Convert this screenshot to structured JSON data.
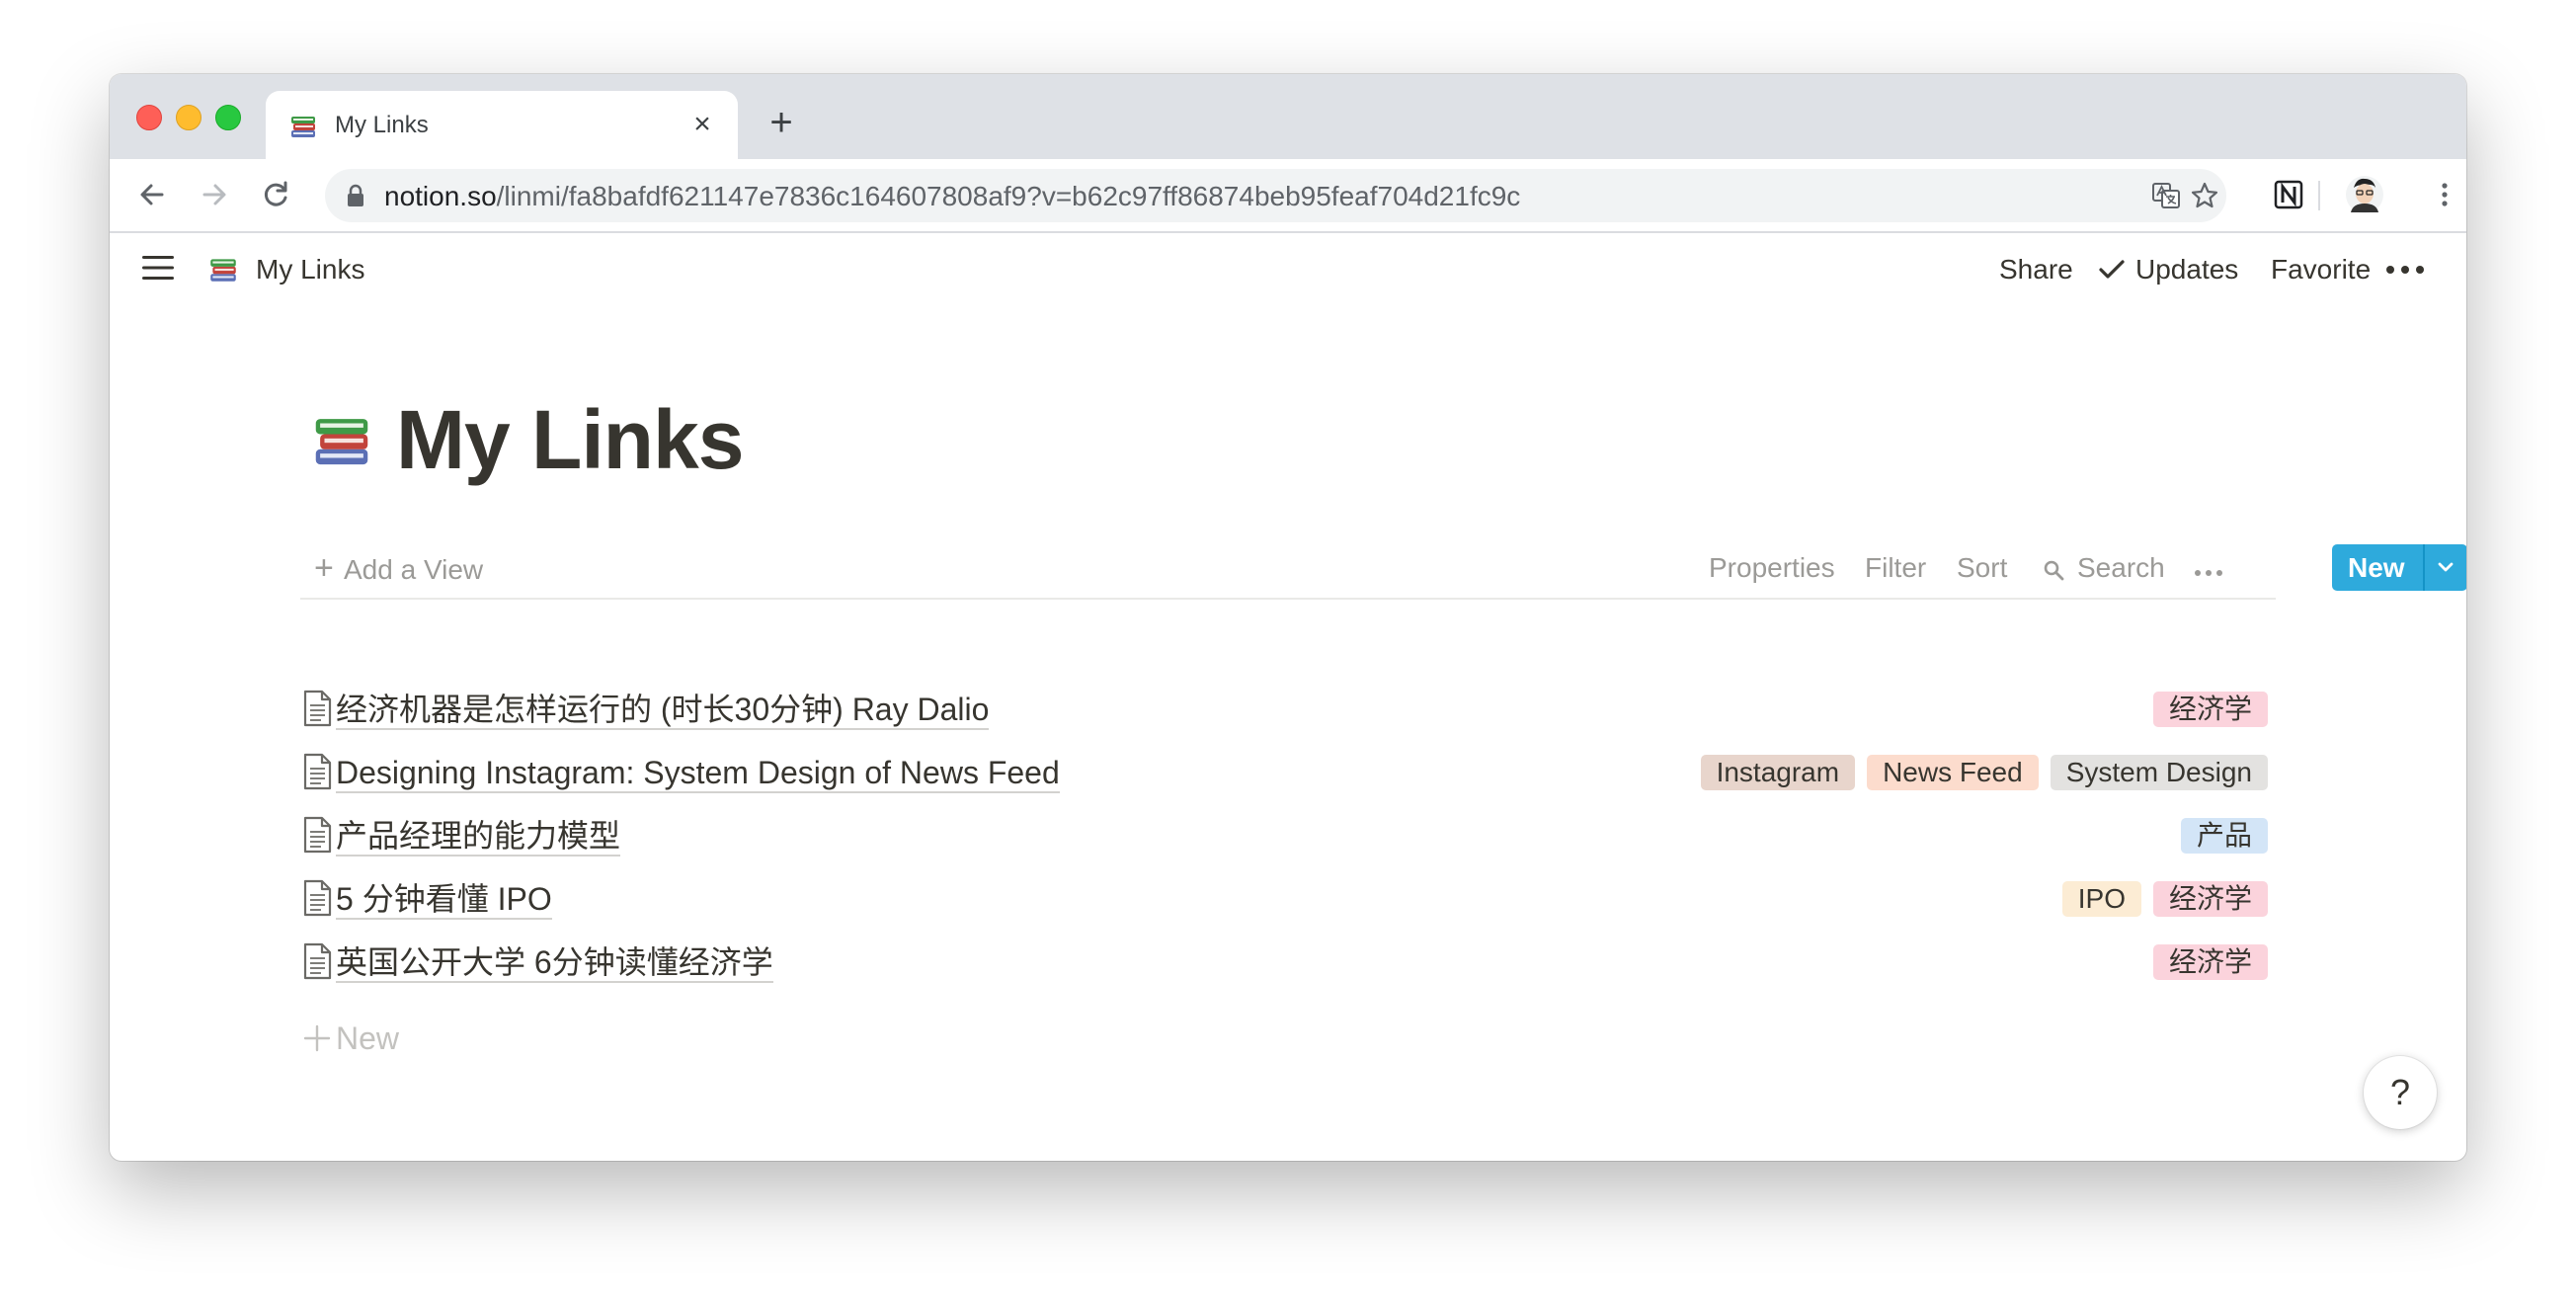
{
  "browser": {
    "tab_title": "My Links",
    "tab_close": "×",
    "new_tab": "+",
    "url_domain": "notion.so",
    "url_path": "/linmi/fa8bafdf621147e7836c164607808af9?v=b62c97ff86874beb95feaf704d21fc9c",
    "icons": [
      "back-icon",
      "forward-icon",
      "reload-icon",
      "lock-icon",
      "translate-icon",
      "star-icon",
      "notion-extension-icon",
      "profile-avatar",
      "kebab-menu-icon"
    ]
  },
  "topbar": {
    "breadcrumb_title": "My Links",
    "share": "Share",
    "updates": "Updates",
    "favorite": "Favorite"
  },
  "page": {
    "title": "My Links",
    "emoji": "books"
  },
  "viewbar": {
    "add_view": "Add a View",
    "properties": "Properties",
    "filter": "Filter",
    "sort": "Sort",
    "search": "Search",
    "new": "New"
  },
  "rows": [
    {
      "title": "经济机器是怎样运行的 (时长30分钟) Ray Dalio",
      "tags": [
        {
          "label": "经济学",
          "color": "#fbd3dc"
        }
      ]
    },
    {
      "title": "Designing Instagram: System Design of News Feed",
      "tags": [
        {
          "label": "Instagram",
          "color": "#e8d5cc"
        },
        {
          "label": "News Feed",
          "color": "#fcdccd"
        },
        {
          "label": "System Design",
          "color": "#e3e2e0"
        }
      ]
    },
    {
      "title": "产品经理的能力模型",
      "tags": [
        {
          "label": "产品",
          "color": "#d3e5f7"
        }
      ]
    },
    {
      "title": "5 分钟看懂 IPO",
      "tags": [
        {
          "label": "IPO",
          "color": "#fcecd4"
        },
        {
          "label": "经济学",
          "color": "#fbd3dc"
        }
      ]
    },
    {
      "title": "英国公开大学 6分钟读懂经济学",
      "tags": [
        {
          "label": "经济学",
          "color": "#fbd3dc"
        }
      ]
    }
  ],
  "add_row": {
    "label": "New"
  },
  "help": {
    "label": "?"
  },
  "colors": {
    "accent": "#2eaadc",
    "text": "#37352f",
    "muted": "#9b9a97"
  }
}
